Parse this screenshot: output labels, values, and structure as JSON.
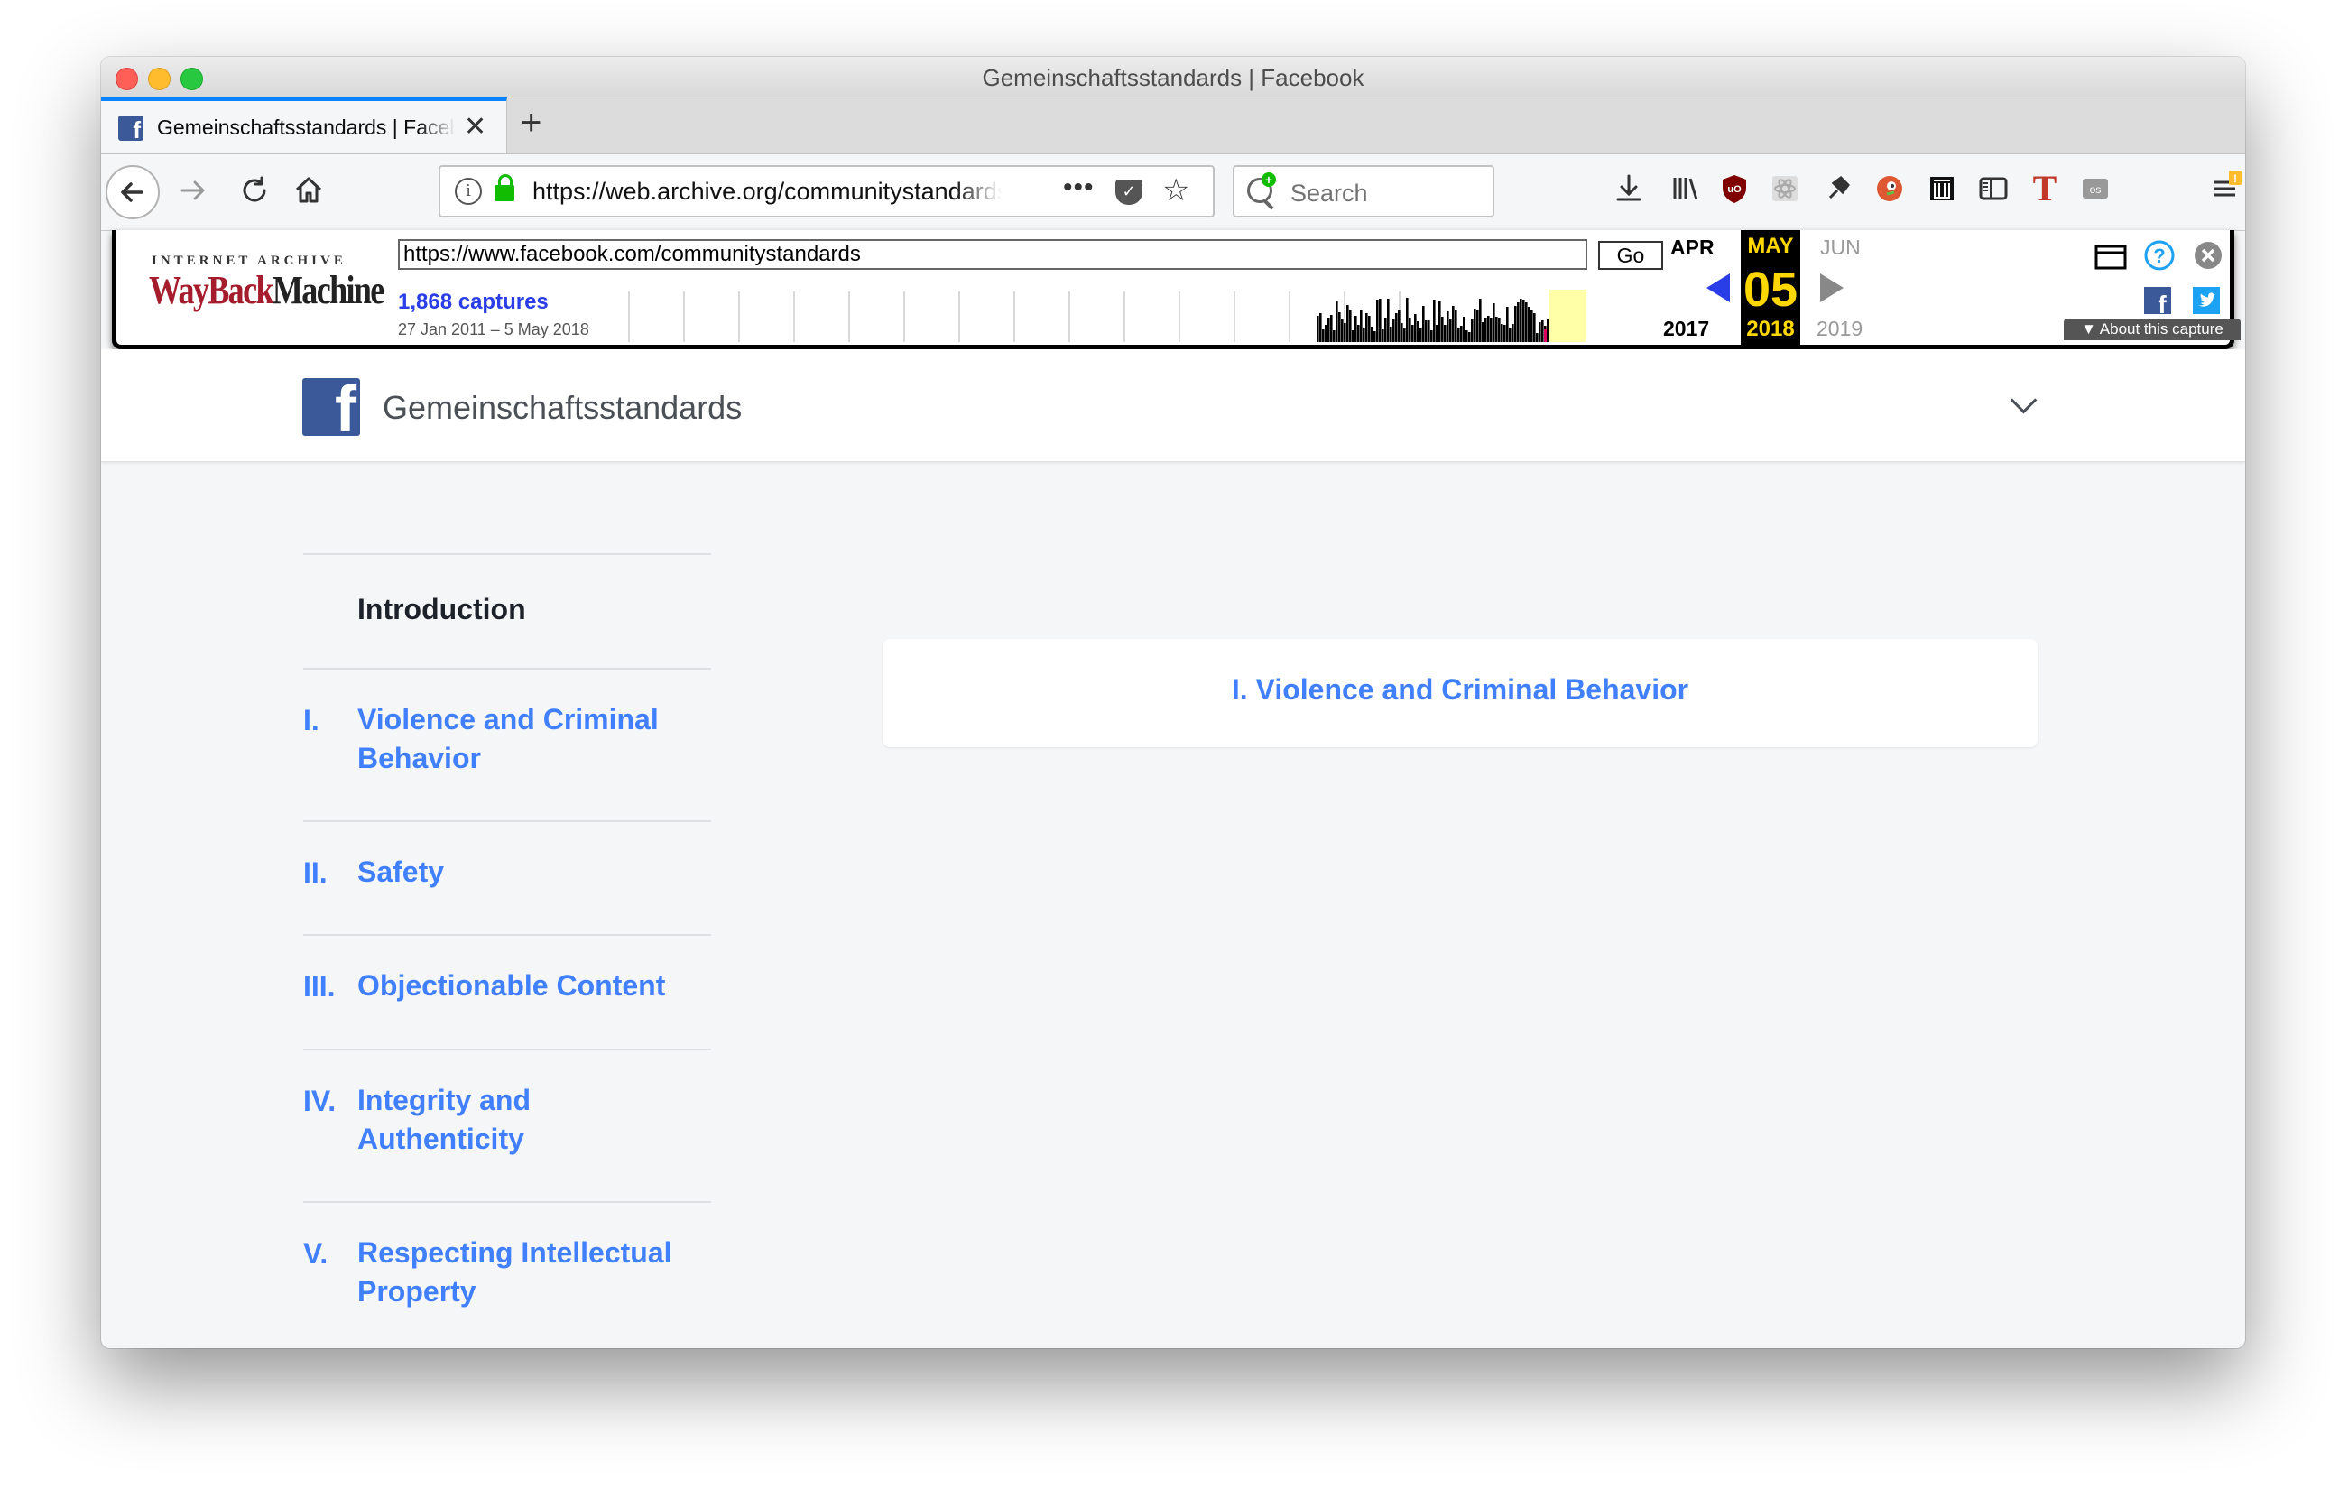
{
  "browser": {
    "window_title": "Gemeinschaftsstandards | Facebook",
    "tab_title": "Gemeinschaftsstandards | Facebook",
    "url": "https://web.archive.org/communitystandards",
    "search_placeholder": "Search",
    "icons": [
      "back-icon",
      "forward-icon",
      "reload-icon",
      "home-icon",
      "info-icon",
      "lock-icon",
      "more-icon",
      "pocket-icon",
      "bookmark-star-icon",
      "download-icon",
      "library-icon",
      "ublock-icon",
      "react-icon",
      "pin-icon",
      "duckduckgo-icon",
      "archive-icon",
      "sidebar-icon",
      "t-icon",
      "lastpass-icon",
      "menu-icon"
    ]
  },
  "wayback": {
    "ia_label": "INTERNET ARCHIVE",
    "logo_part1": "WayBack",
    "logo_part2": "Machine",
    "url_value": "https://www.facebook.com/communitystandards",
    "go_label": "Go",
    "captures": "1,868 captures",
    "range": "27 Jan 2011 – 5 May 2018",
    "prev_month": "APR",
    "cur_month": "MAY",
    "next_month": "JUN",
    "day": "05",
    "prev_year": "2017",
    "cur_year": "2018",
    "next_year": "2019",
    "about_label": "▼ About this capture",
    "colors": {
      "accent": "#2a3ee8",
      "highlight": "#ffd700",
      "logo_red": "#a51d2d"
    }
  },
  "facebook": {
    "header_title": "Gemeinschaftsstandards",
    "brand_color": "#3b5998",
    "link_color": "#4080ff",
    "nav": {
      "intro": "Introduction",
      "items": [
        {
          "num": "I.",
          "label": "Violence and Criminal Behavior"
        },
        {
          "num": "II.",
          "label": "Safety"
        },
        {
          "num": "III.",
          "label": "Objectionable Content"
        },
        {
          "num": "IV.",
          "label": "Integrity and Authenticity"
        },
        {
          "num": "V.",
          "label": "Respecting Intellectual Property"
        }
      ]
    },
    "card_title": "I. Violence and Criminal Behavior"
  }
}
